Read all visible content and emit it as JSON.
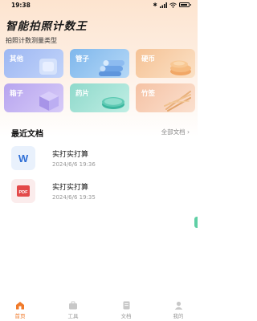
{
  "status": {
    "time": "19:38",
    "battery_icon": "battery-icon",
    "signal": "wifi-signal-icons"
  },
  "app": {
    "title": "智能拍照计数王",
    "subtitle": "拍照计数测量类型"
  },
  "categories": [
    {
      "label": "其他",
      "icon": "other-icon",
      "color": "#a9c3f5"
    },
    {
      "label": "管子",
      "icon": "pipe-icon",
      "color": "#8ec3ef"
    },
    {
      "label": "硬币",
      "icon": "coin-icon",
      "color": "#f7d3ad"
    },
    {
      "label": "箱子",
      "icon": "box-icon",
      "color": "#c4b2f2"
    },
    {
      "label": "药片",
      "icon": "pill-icon",
      "color": "#9fe0d3"
    },
    {
      "label": "竹签",
      "icon": "skewer-icon",
      "color": "#f7cdb4"
    }
  ],
  "recent": {
    "header": "最近文档",
    "all_label": "全部文档",
    "docs": [
      {
        "title": "实打实打算",
        "date": "2024/6/6 19:36",
        "type": "W"
      },
      {
        "title": "实打实打算",
        "date": "2024/6/6 19:35",
        "type": "PDF"
      }
    ]
  },
  "tabs": [
    {
      "label": "首页",
      "active": true
    },
    {
      "label": "工具",
      "active": false
    },
    {
      "label": "文档",
      "active": false
    },
    {
      "label": "我的",
      "active": false
    }
  ],
  "colors": {
    "accent": "#f07a2a",
    "header_bg": "#fde4cf"
  }
}
